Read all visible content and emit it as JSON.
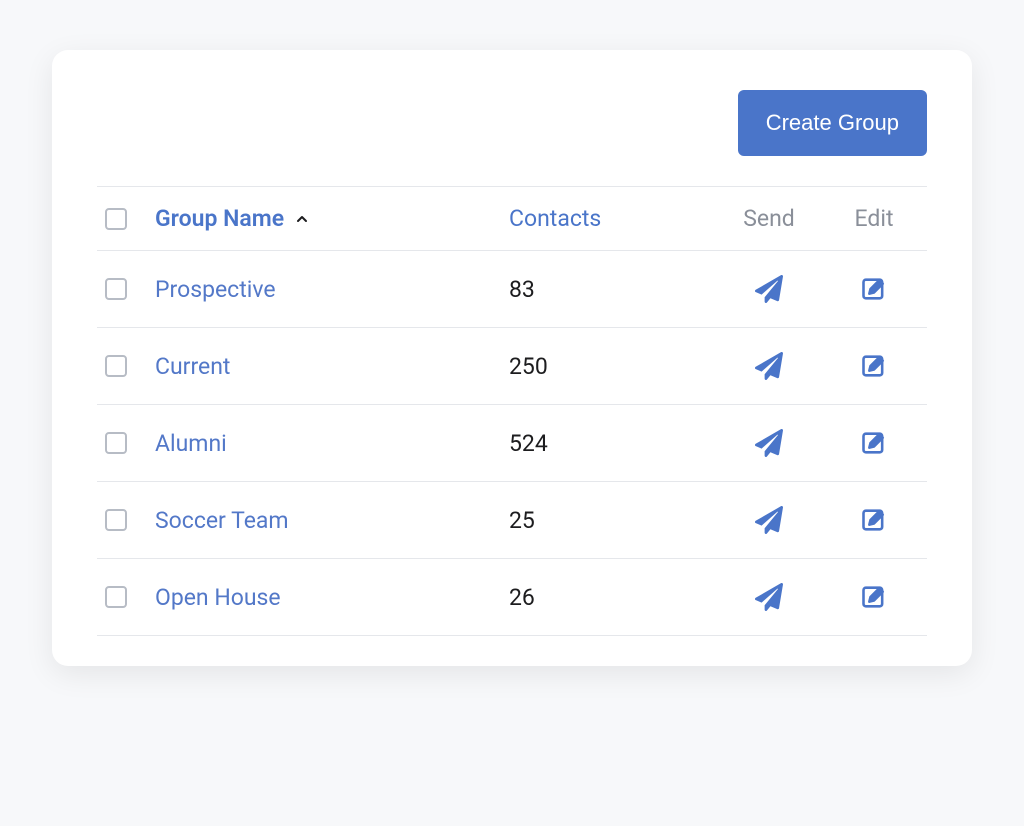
{
  "actions": {
    "create_group_label": "Create Group"
  },
  "columns": {
    "group_name": "Group Name",
    "contacts": "Contacts",
    "send": "Send",
    "edit": "Edit"
  },
  "rows": [
    {
      "name": "Prospective",
      "contacts": "83"
    },
    {
      "name": "Current",
      "contacts": "250"
    },
    {
      "name": "Alumni",
      "contacts": "524"
    },
    {
      "name": "Soccer Team",
      "contacts": "25"
    },
    {
      "name": "Open House",
      "contacts": "26"
    }
  ],
  "colors": {
    "accent": "#4a75c9",
    "link": "#5378c8",
    "muted": "#8a8f99",
    "border": "#e5e7eb"
  }
}
